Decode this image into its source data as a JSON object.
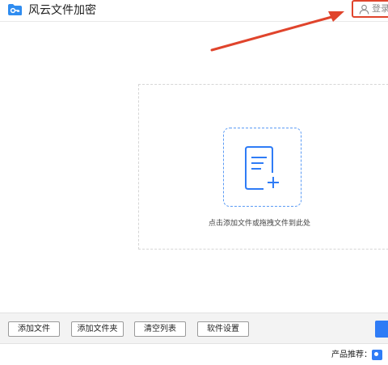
{
  "app": {
    "title": "风云文件加密",
    "logo_icon": "key-folder-icon",
    "accent_color": "#2f7cf6"
  },
  "header": {
    "login_label": "登录",
    "login_icon": "user-icon",
    "highlight_color": "#e0442c"
  },
  "dropzone": {
    "icon": "file-plus-icon",
    "hint": "点击添加文件或拖拽文件到此处"
  },
  "toolbar": {
    "add_file": "添加文件",
    "add_folder": "添加文件夹",
    "clear_list": "清空列表",
    "settings": "软件设置"
  },
  "footer": {
    "promo_label": "产品推荐：",
    "promo_icon": "app-icon"
  }
}
